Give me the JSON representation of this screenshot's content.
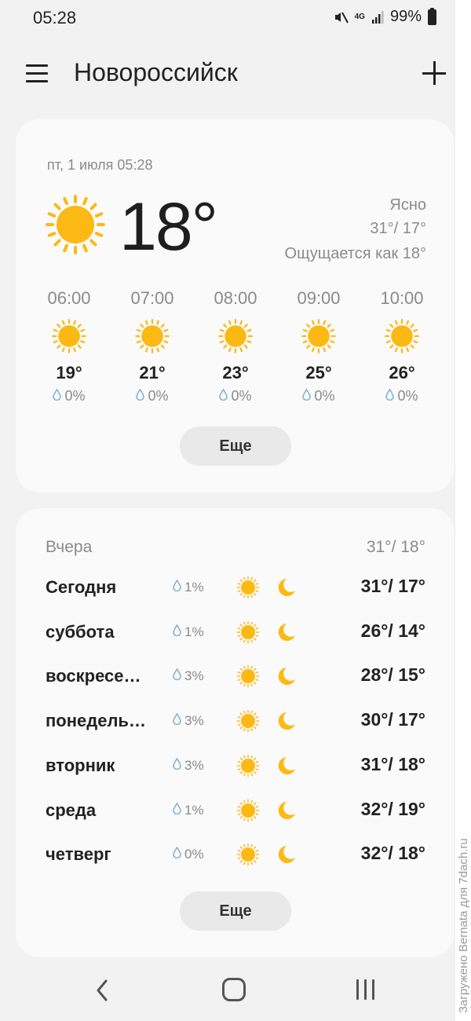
{
  "status_bar": {
    "time": "05:28",
    "network": "4G",
    "battery": "99%",
    "icons": [
      "mute-icon",
      "network-4g-icon",
      "signal-icon",
      "battery-icon"
    ]
  },
  "header": {
    "city": "Новороссийск",
    "menu_icon": "menu-icon",
    "add_icon": "add-icon"
  },
  "current": {
    "date": "пт, 1 июля 05:28",
    "temp": "18°",
    "condition": "Ясно",
    "high_low": "31°/ 17°",
    "feels_like": "Ощущается как 18°",
    "icon": "sun-icon"
  },
  "hourly": [
    {
      "time": "06:00",
      "temp": "19°",
      "precip": "0%"
    },
    {
      "time": "07:00",
      "temp": "21°",
      "precip": "0%"
    },
    {
      "time": "08:00",
      "temp": "23°",
      "precip": "0%"
    },
    {
      "time": "09:00",
      "temp": "25°",
      "precip": "0%"
    },
    {
      "time": "10:00",
      "temp": "26°",
      "precip": "0%"
    }
  ],
  "hourly_more_label": "Еще",
  "yesterday": {
    "label": "Вчера",
    "temps": "31°/ 18°"
  },
  "daily": [
    {
      "day": "Сегодня",
      "precip": "1%",
      "temps": "31°/ 17°"
    },
    {
      "day": "суббота",
      "precip": "1%",
      "temps": "26°/ 14°"
    },
    {
      "day": "воскресе…",
      "precip": "3%",
      "temps": "28°/ 15°"
    },
    {
      "day": "понедель…",
      "precip": "3%",
      "temps": "30°/ 17°"
    },
    {
      "day": "вторник",
      "precip": "3%",
      "temps": "31°/ 18°"
    },
    {
      "day": "среда",
      "precip": "1%",
      "temps": "32°/ 19°"
    },
    {
      "day": "четверг",
      "precip": "0%",
      "temps": "32°/ 18°"
    }
  ],
  "daily_more_label": "Еще",
  "watermark": "Загружено Bernata для 7dach.ru",
  "colors": {
    "sun": "#fdb913",
    "drop": "#7fb2d9",
    "background": "#f2f2f2",
    "card": "#fafafa",
    "button": "#e9e9e9"
  }
}
